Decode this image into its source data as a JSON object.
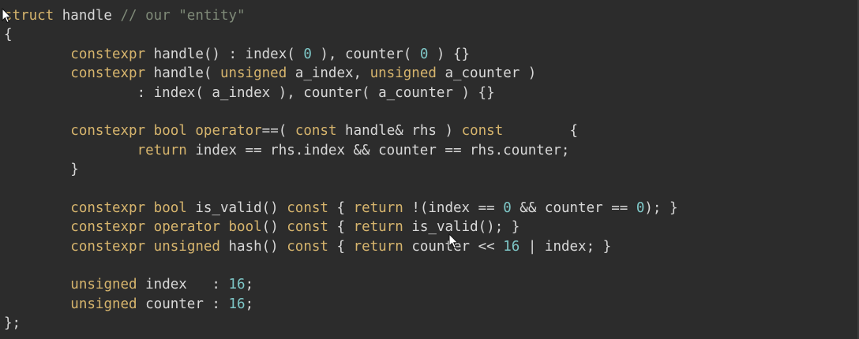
{
  "editor": {
    "colors": {
      "background": "#2c2c2c",
      "text": "#d8d8d8",
      "keyword": "#d7b56d",
      "comment": "#7f8a78",
      "number": "#7ec7c7"
    },
    "lines": [
      [
        {
          "t": "struct",
          "k": "kw"
        },
        {
          "t": " handle ",
          "k": "tx"
        },
        {
          "t": "// our \"entity\"",
          "k": "cm"
        }
      ],
      [
        {
          "t": "{",
          "k": "tx"
        }
      ],
      [
        {
          "t": "        ",
          "k": "tx"
        },
        {
          "t": "constexpr",
          "k": "kw"
        },
        {
          "t": " handle() : index( ",
          "k": "tx"
        },
        {
          "t": "0",
          "k": "num"
        },
        {
          "t": " ), counter( ",
          "k": "tx"
        },
        {
          "t": "0",
          "k": "num"
        },
        {
          "t": " ) {}",
          "k": "tx"
        }
      ],
      [
        {
          "t": "        ",
          "k": "tx"
        },
        {
          "t": "constexpr",
          "k": "kw"
        },
        {
          "t": " handle( ",
          "k": "tx"
        },
        {
          "t": "unsigned",
          "k": "kw"
        },
        {
          "t": " a_index, ",
          "k": "tx"
        },
        {
          "t": "unsigned",
          "k": "kw"
        },
        {
          "t": " a_counter )",
          "k": "tx"
        }
      ],
      [
        {
          "t": "                : index( a_index ), counter( a_counter ) {}",
          "k": "tx"
        }
      ],
      [],
      [
        {
          "t": "        ",
          "k": "tx"
        },
        {
          "t": "constexpr",
          "k": "kw"
        },
        {
          "t": " ",
          "k": "tx"
        },
        {
          "t": "bool",
          "k": "kw"
        },
        {
          "t": " ",
          "k": "tx"
        },
        {
          "t": "operator",
          "k": "kw"
        },
        {
          "t": "==( ",
          "k": "tx"
        },
        {
          "t": "const",
          "k": "kw"
        },
        {
          "t": " handle& rhs ) ",
          "k": "tx"
        },
        {
          "t": "const",
          "k": "kw"
        },
        {
          "t": "        {",
          "k": "tx"
        }
      ],
      [
        {
          "t": "                ",
          "k": "tx"
        },
        {
          "t": "return",
          "k": "kw"
        },
        {
          "t": " index == rhs.index && counter == rhs.counter;",
          "k": "tx"
        }
      ],
      [
        {
          "t": "        }",
          "k": "tx"
        }
      ],
      [],
      [
        {
          "t": "        ",
          "k": "tx"
        },
        {
          "t": "constexpr",
          "k": "kw"
        },
        {
          "t": " ",
          "k": "tx"
        },
        {
          "t": "bool",
          "k": "kw"
        },
        {
          "t": " is_valid() ",
          "k": "tx"
        },
        {
          "t": "const",
          "k": "kw"
        },
        {
          "t": " { ",
          "k": "tx"
        },
        {
          "t": "return",
          "k": "kw"
        },
        {
          "t": " !(index == ",
          "k": "tx"
        },
        {
          "t": "0",
          "k": "num"
        },
        {
          "t": " && counter == ",
          "k": "tx"
        },
        {
          "t": "0",
          "k": "num"
        },
        {
          "t": "); }",
          "k": "tx"
        }
      ],
      [
        {
          "t": "        ",
          "k": "tx"
        },
        {
          "t": "constexpr",
          "k": "kw"
        },
        {
          "t": " ",
          "k": "tx"
        },
        {
          "t": "operator",
          "k": "kw"
        },
        {
          "t": " ",
          "k": "tx"
        },
        {
          "t": "bool",
          "k": "kw"
        },
        {
          "t": "() ",
          "k": "tx"
        },
        {
          "t": "const",
          "k": "kw"
        },
        {
          "t": " { ",
          "k": "tx"
        },
        {
          "t": "return",
          "k": "kw"
        },
        {
          "t": " is_valid(); }",
          "k": "tx"
        }
      ],
      [
        {
          "t": "        ",
          "k": "tx"
        },
        {
          "t": "constexpr",
          "k": "kw"
        },
        {
          "t": " ",
          "k": "tx"
        },
        {
          "t": "unsigned",
          "k": "kw"
        },
        {
          "t": " hash() ",
          "k": "tx"
        },
        {
          "t": "const",
          "k": "kw"
        },
        {
          "t": " { ",
          "k": "tx"
        },
        {
          "t": "return",
          "k": "kw"
        },
        {
          "t": " counter << ",
          "k": "tx"
        },
        {
          "t": "16",
          "k": "num"
        },
        {
          "t": " | index; }",
          "k": "tx"
        }
      ],
      [],
      [
        {
          "t": "        ",
          "k": "tx"
        },
        {
          "t": "unsigned",
          "k": "kw"
        },
        {
          "t": " index   : ",
          "k": "tx"
        },
        {
          "t": "16",
          "k": "num"
        },
        {
          "t": ";",
          "k": "tx"
        }
      ],
      [
        {
          "t": "        ",
          "k": "tx"
        },
        {
          "t": "unsigned",
          "k": "kw"
        },
        {
          "t": " counter : ",
          "k": "tx"
        },
        {
          "t": "16",
          "k": "num"
        },
        {
          "t": ";",
          "k": "tx"
        }
      ],
      [
        {
          "t": "};",
          "k": "tx"
        }
      ]
    ]
  }
}
